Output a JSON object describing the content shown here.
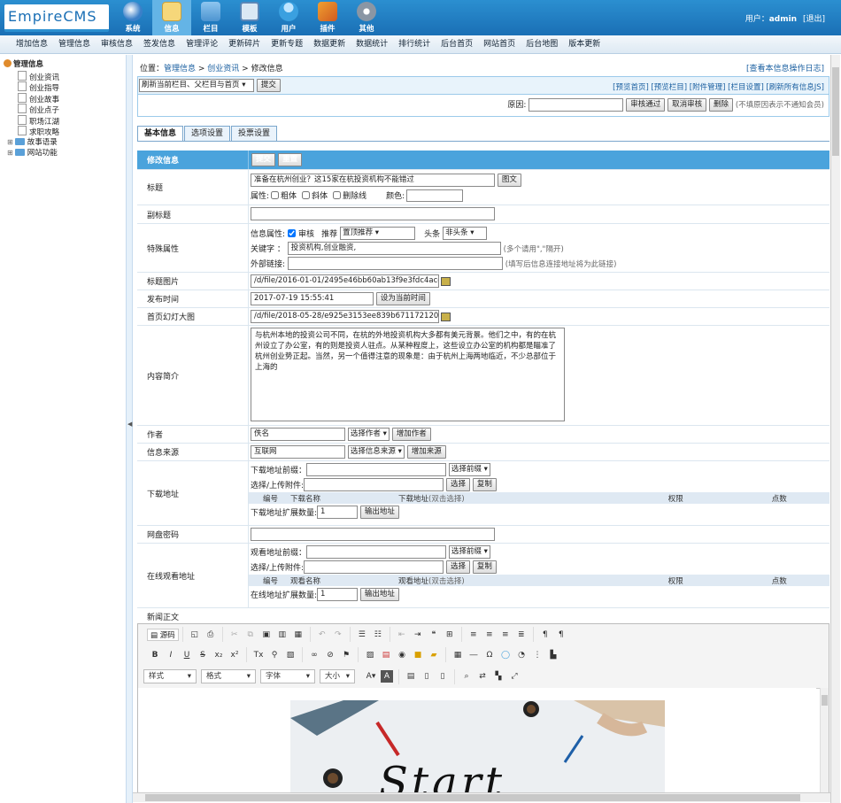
{
  "app": {
    "logo": "EmpireCMS",
    "user_label": "用户：",
    "user_name": "admin",
    "logout": "[退出]"
  },
  "modules": [
    {
      "label": "系统",
      "icon": "globe-icon"
    },
    {
      "label": "信息",
      "icon": "edit-icon",
      "active": true
    },
    {
      "label": "栏目",
      "icon": "folder-icon"
    },
    {
      "label": "模板",
      "icon": "template-icon"
    },
    {
      "label": "用户",
      "icon": "user-icon"
    },
    {
      "label": "插件",
      "icon": "plugin-icon"
    },
    {
      "label": "其他",
      "icon": "gear-icon"
    }
  ],
  "subnav": [
    "增加信息",
    "管理信息",
    "审核信息",
    "签发信息",
    "管理评论",
    "更新碎片",
    "更新专题",
    "数据更新",
    "数据统计",
    "排行统计",
    "后台首页",
    "网站首页",
    "后台地图",
    "版本更新"
  ],
  "sidebar": {
    "root": "管理信息",
    "items": [
      "创业资讯",
      "创业指导",
      "创业故事",
      "创业点子",
      "职场江湖",
      "求职攻略"
    ],
    "folders": [
      "故事语录",
      "网站功能"
    ]
  },
  "crumb": {
    "prefix": "位置：",
    "l1": "管理信息",
    "sep": " > ",
    "l2": "创业资讯",
    "l3": "修改信息"
  },
  "log_link": "[查看本信息操作日志]",
  "refresh": {
    "select": "刷新当前栏目、父栏目与首页",
    "submit": "提交"
  },
  "preview_links": "[预览首页] [预览栏目] [附件管理] [栏目设置] [刷新所有信息JS]",
  "audit": {
    "reason_label": "原因:",
    "pass": "审核通过",
    "cancel": "取消审核",
    "delete": "删除",
    "hint": "(不填原因表示不通知会员)"
  },
  "tabs": [
    "基本信息",
    "选项设置",
    "投票设置"
  ],
  "form": {
    "header": "修改信息",
    "submit": "提交",
    "reset": "重置",
    "title_label": "标题",
    "title_value": "准备在杭州创业？这15家在杭投资机构不能错过",
    "title_btn": "图文",
    "attr_label": "属性:",
    "bold": "粗体",
    "italic": "斜体",
    "strike": "删除线",
    "color_label": "颜色:",
    "subtitle_label": "副标题",
    "special_label": "特殊属性",
    "info_attr": "信息属性:",
    "audit": "审核",
    "recommend": "推荐",
    "recommend_val": "置顶推荐",
    "headline": "头条",
    "headline_val": "非头条",
    "keywords_label": "关键字 ：",
    "keywords_value": "投资机构,创业融资,",
    "keywords_hint": "(多个请用\",\"隔开)",
    "ext_label": "外部链接:",
    "ext_hint": "(填写后信息连接地址将为此链接)",
    "titlepic_label": "标题图片",
    "titlepic_value": "/d/file/2016-01-01/2495e46bb60ab13f9e3fdc4accc5963",
    "time_label": "发布时间",
    "time_value": "2017-07-19 15:55:41",
    "time_btn": "设为当前时间",
    "flash_label": "首页幻灯大图",
    "flash_value": "/d/file/2018-05-28/e925e3153ee839b671172120445a2",
    "intro_label": "内容简介",
    "intro_value": "与杭州本地的投资公司不同，在杭的外地投资机构大多都有美元背景。他们之中，有的在杭州设立了办公室，有的则是投资人驻点。从某种程度上，这些设立办公室的机构都是瞄准了杭州创业势正起。当然，另一个值得注意的现象是：由于杭州上海两地临近，不少总部位于上海的",
    "author_label": "作者",
    "author_value": "佚名",
    "author_select": "选择作者",
    "author_add": "增加作者",
    "source_label": "信息来源",
    "source_value": "互联网",
    "source_select": "选择信息来源",
    "source_add": "增加来源",
    "download_label": "下载地址",
    "dl_prefix": "下载地址前缀：",
    "dl_prefix_sel": "选择前缀",
    "dl_upload": "选择/上传附件:",
    "select": "选择",
    "copy": "复制",
    "dl_cols": [
      "编号",
      "下载名称",
      "下载地址",
      "(双击选择)",
      "权限",
      "点数"
    ],
    "dl_count_label": "下载地址扩展数量:",
    "dl_count": "1",
    "dl_output": "输出地址",
    "pan_label": "网盘密码",
    "online_label": "在线观看地址",
    "ol_prefix": "观看地址前缀：",
    "ol_cols": [
      "编号",
      "观看名称",
      "观看地址",
      "(双击选择)",
      "权限",
      "点数"
    ],
    "ol_count_label": "在线地址扩展数量:",
    "ol_output": "输出地址",
    "body_label": "新闻正文"
  },
  "editor": {
    "source": "源码",
    "dd_style": "样式",
    "dd_format": "格式",
    "dd_font": "字体",
    "dd_size": "大小",
    "image_text": "Start"
  }
}
